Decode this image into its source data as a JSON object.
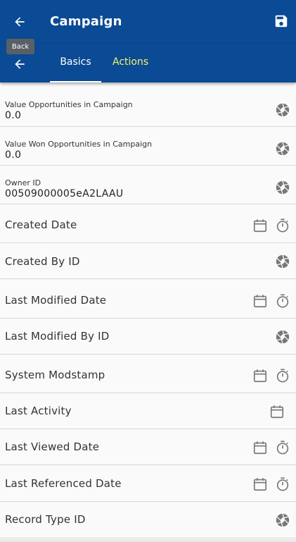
{
  "header": {
    "title": "Campaign",
    "back_tooltip": "Back"
  },
  "tabs": [
    {
      "label": "Basics",
      "active": true
    },
    {
      "label": "Actions",
      "active": false
    }
  ],
  "fields": [
    {
      "label": "Value Opportunities in Campaign",
      "value": "0.0",
      "icons": [
        "aperture-icon"
      ]
    },
    {
      "label": "Value Won Opportunities in Campaign",
      "value": "0.0",
      "icons": [
        "aperture-icon"
      ]
    },
    {
      "label": "Owner ID",
      "value": "00509000005eA2LAAU",
      "icons": [
        "aperture-icon"
      ]
    },
    {
      "label": "Created Date",
      "icons": [
        "calendar-icon",
        "timer-icon"
      ]
    },
    {
      "label": "Created By ID",
      "icons": [
        "aperture-icon"
      ]
    },
    {
      "label": "Last Modified Date",
      "icons": [
        "calendar-icon",
        "timer-icon"
      ]
    },
    {
      "label": "Last Modified By ID",
      "icons": [
        "aperture-icon"
      ]
    },
    {
      "label": "System Modstamp",
      "icons": [
        "calendar-icon",
        "timer-icon"
      ]
    },
    {
      "label": "Last Activity",
      "icons": [
        "calendar-icon"
      ]
    },
    {
      "label": "Last Viewed Date",
      "icons": [
        "calendar-icon",
        "timer-icon"
      ]
    },
    {
      "label": "Last Referenced Date",
      "icons": [
        "calendar-icon",
        "timer-icon"
      ]
    },
    {
      "label": "Record Type ID",
      "icons": [
        "aperture-icon"
      ]
    }
  ],
  "colors": {
    "primary": "#0b4a94",
    "active_tab": "#ffffff",
    "inactive_tab": "#f2f56b",
    "icon": "#777777"
  }
}
